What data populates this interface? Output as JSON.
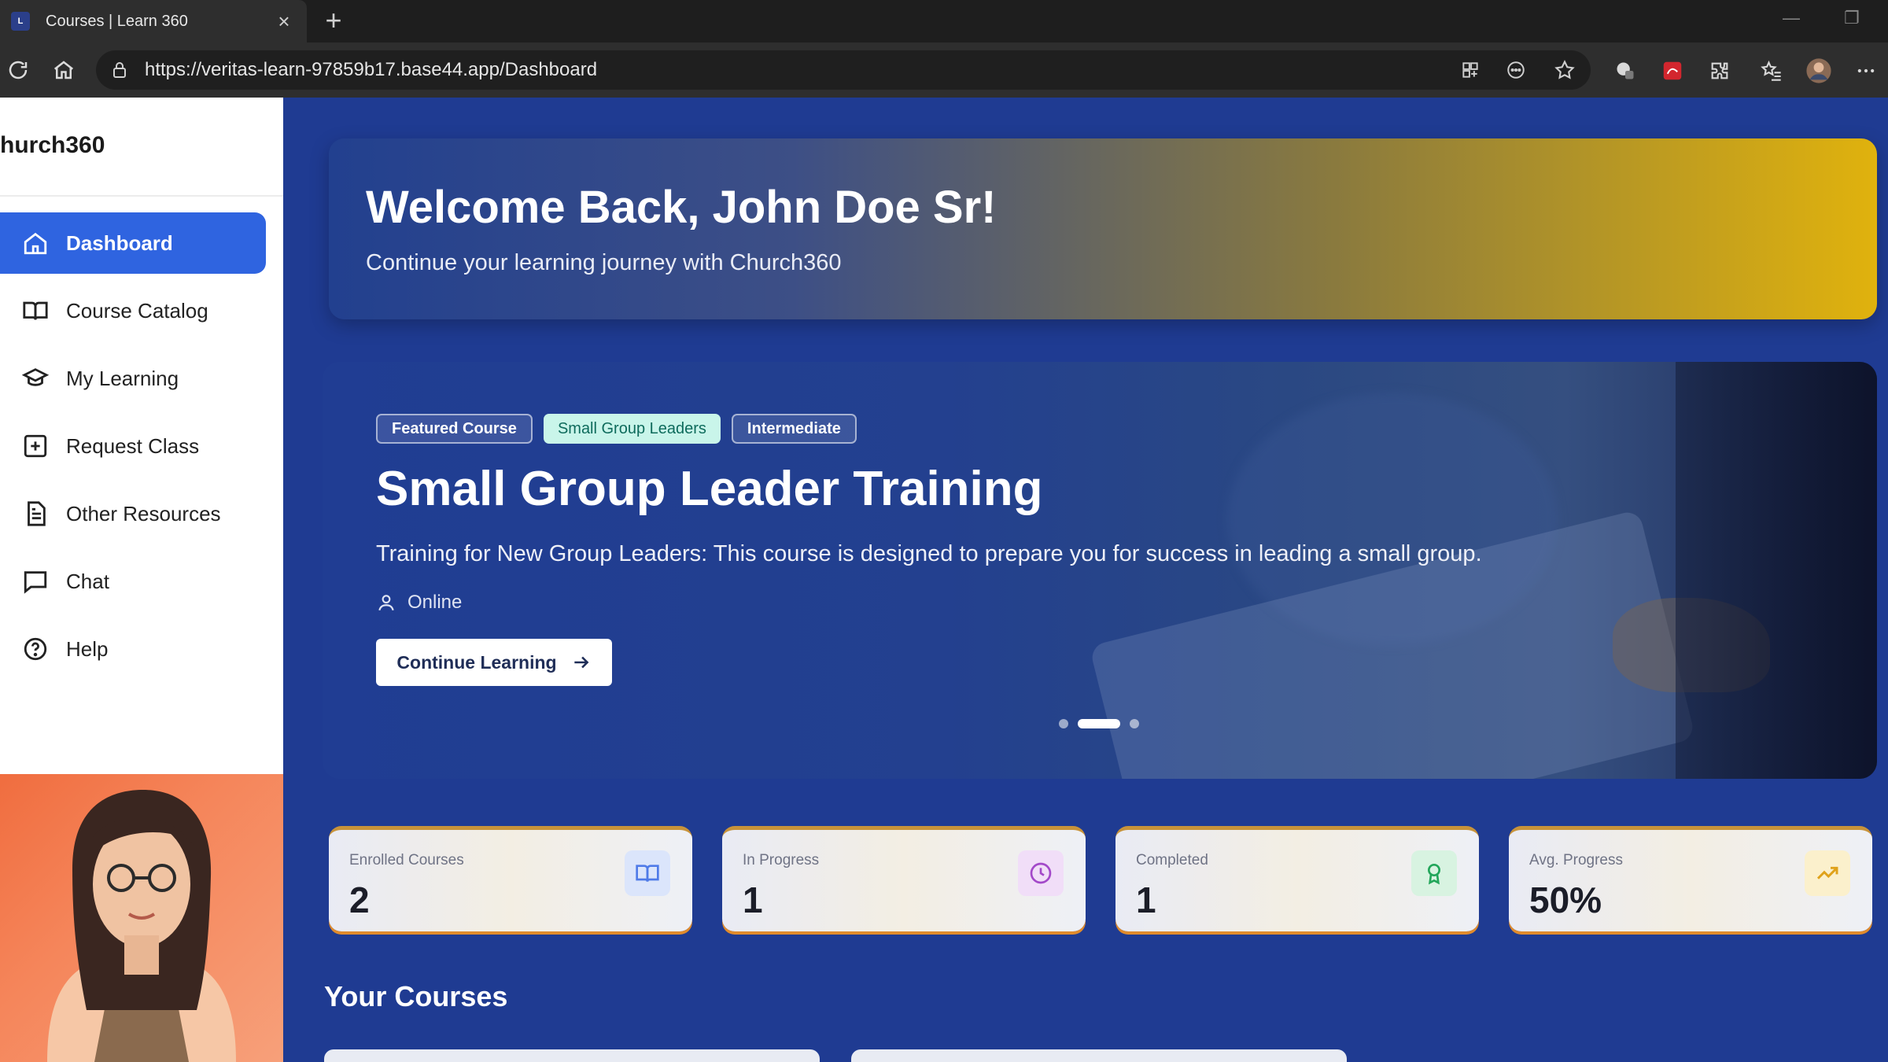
{
  "browser": {
    "tab_title": "Courses | Learn 360",
    "tab_favicon": "L",
    "url": "https://veritas-learn-97859b17.base44.app/Dashboard"
  },
  "sidebar": {
    "brand": "hurch360",
    "items": [
      {
        "label": "Dashboard",
        "icon": "home-icon",
        "active": true
      },
      {
        "label": "Course Catalog",
        "icon": "book-open-icon"
      },
      {
        "label": "My Learning",
        "icon": "graduation-cap-icon"
      },
      {
        "label": "Request Class",
        "icon": "plus-square-icon"
      },
      {
        "label": "Other Resources",
        "icon": "file-text-icon"
      },
      {
        "label": "Chat",
        "icon": "message-square-icon"
      },
      {
        "label": "Help",
        "icon": "help-circle-icon"
      }
    ]
  },
  "welcome": {
    "title": "Welcome Back, John Doe Sr!",
    "subtitle": "Continue your learning journey with Church360"
  },
  "hero": {
    "tags": [
      "Featured Course",
      "Small Group Leaders",
      "Intermediate"
    ],
    "title": "Small Group Leader Training",
    "description": "Training for New Group Leaders: This course is designed to prepare you for success in leading a small group.",
    "mode": "Online",
    "cta_label": "Continue Learning",
    "slides": 3,
    "active_slide": 2
  },
  "stats": [
    {
      "label": "Enrolled Courses",
      "value": "2",
      "icon": "book-open-icon",
      "color": "#4f7be8"
    },
    {
      "label": "In Progress",
      "value": "1",
      "icon": "clock-icon",
      "color": "#a349c9"
    },
    {
      "label": "Completed",
      "value": "1",
      "icon": "award-icon",
      "color": "#22a65a"
    },
    {
      "label": "Avg. Progress",
      "value": "50%",
      "icon": "trending-up-icon",
      "color": "#e0a21a"
    }
  ],
  "sections": {
    "your_courses": "Your Courses"
  },
  "colors": {
    "accent": "#2f64e0",
    "main_bg": "#1f3b92",
    "welcome_gold": "#e0b20d"
  }
}
